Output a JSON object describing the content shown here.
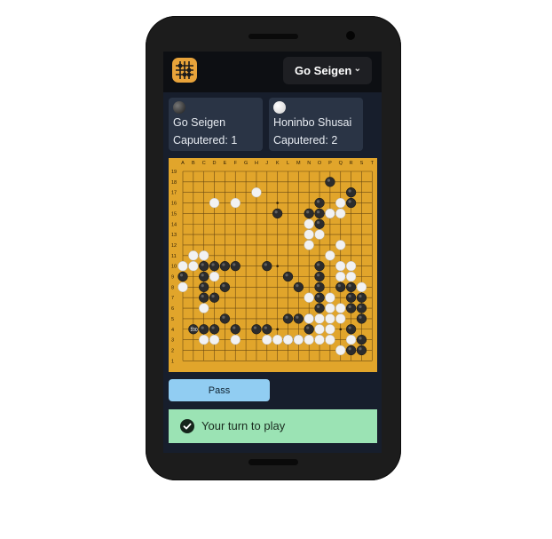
{
  "header": {
    "logo_icon": "go-board-logo-icon",
    "selected_player": "Go Seigen",
    "dropdown_icon": "chevron-down-icon"
  },
  "players": [
    {
      "stone": "black",
      "name": "Go Seigen",
      "captured_label": "Caputered: 1"
    },
    {
      "stone": "white",
      "name": "Honinbo Shusai",
      "captured_label": "Caputered: 2"
    }
  ],
  "board": {
    "size": 19,
    "columns": [
      "A",
      "B",
      "C",
      "D",
      "E",
      "F",
      "G",
      "H",
      "J",
      "K",
      "L",
      "M",
      "N",
      "O",
      "P",
      "Q",
      "R",
      "S",
      "T"
    ],
    "rows": [
      "19",
      "18",
      "17",
      "16",
      "15",
      "14",
      "13",
      "12",
      "11",
      "10",
      "9",
      "8",
      "7",
      "6",
      "5",
      "4",
      "3",
      "2",
      "1"
    ],
    "move_label": "100",
    "colors": {
      "board": "#e1a52b",
      "line": "#6b4a12",
      "black_stone": "#3a3a3a",
      "white_stone": "#f2f2f2"
    },
    "stones": {
      "black": [
        "P18",
        "R17",
        "R16",
        "O16",
        "K15",
        "N15",
        "O15",
        "P15",
        "O14",
        "C10",
        "D10",
        "E10",
        "F10",
        "J10",
        "O10",
        "A9",
        "C9",
        "L9",
        "O9",
        "C8",
        "E8",
        "M8",
        "O8",
        "Q8",
        "R8",
        "C7",
        "D7",
        "O7",
        "R7",
        "S7",
        "O6",
        "R6",
        "S6",
        "E5",
        "L5",
        "M5",
        "N5",
        "S5",
        "B4",
        "C4",
        "D4",
        "F4",
        "H4",
        "J4",
        "N4",
        "R4",
        "L3",
        "M3",
        "S3",
        "R2",
        "S2"
      ],
      "white": [
        "H17",
        "D16",
        "F16",
        "Q16",
        "P15",
        "Q15",
        "N14",
        "N13",
        "O13",
        "N12",
        "Q12",
        "B11",
        "C11",
        "P11",
        "B10",
        "D10x",
        "A10",
        "O10x",
        "Q10",
        "R10",
        "D9",
        "Q9",
        "R9",
        "A8",
        "Q8x",
        "S8",
        "N7",
        "P7",
        "C6",
        "P6",
        "Q6",
        "R6x",
        "N5",
        "O5",
        "P5",
        "Q5",
        "O4",
        "P4",
        "R4x",
        "C3",
        "D3",
        "F3",
        "J3",
        "K3",
        "L3",
        "M3",
        "N3",
        "O3",
        "P3",
        "R3",
        "Q2"
      ],
      "star_points": [
        "D16",
        "K16",
        "Q16",
        "D10",
        "K10",
        "Q10",
        "D4",
        "K4",
        "Q4"
      ]
    }
  },
  "actions": {
    "pass_label": "Pass"
  },
  "status": {
    "icon": "check-circle-icon",
    "message": "Your turn to play",
    "color": "#9be3b4"
  }
}
